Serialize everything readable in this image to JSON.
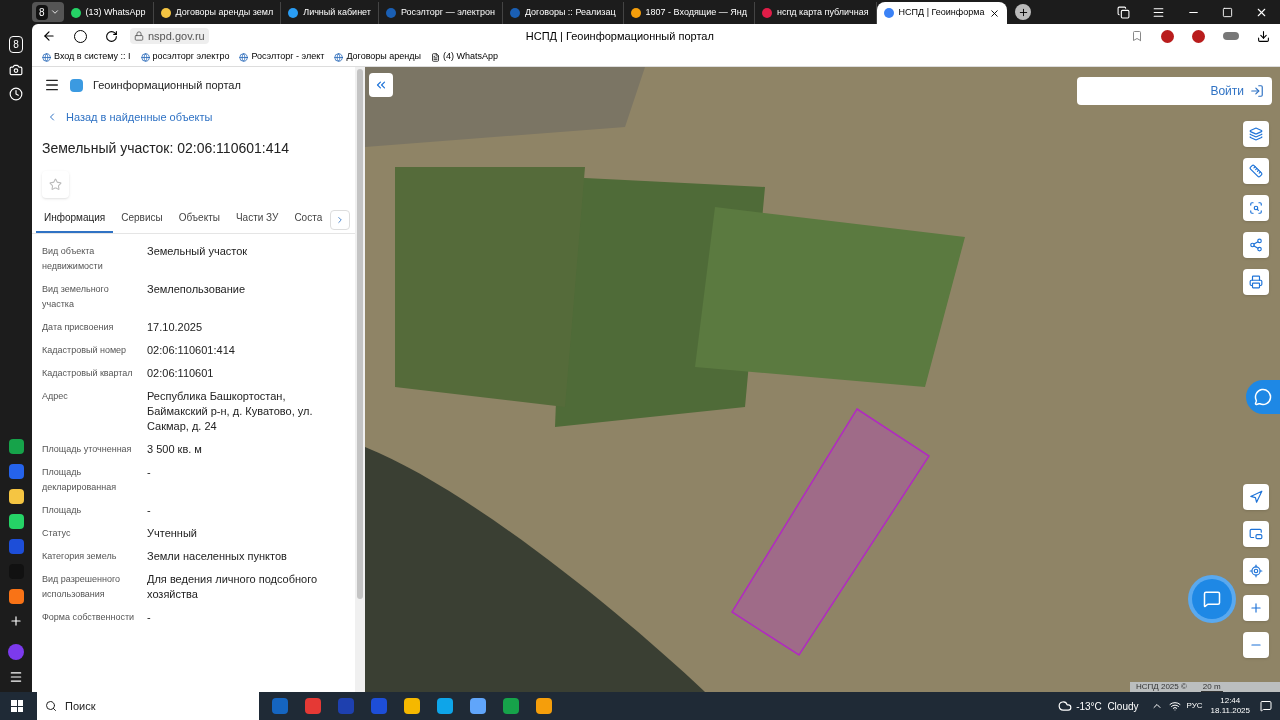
{
  "browser": {
    "group_count": "8",
    "tabs": [
      {
        "label": "(13) WhatsApp",
        "selected": false
      },
      {
        "label": "Договоры аренды земл",
        "selected": false
      },
      {
        "label": "Личный кабинет",
        "selected": false
      },
      {
        "label": "Росэлторг — электрон",
        "selected": false
      },
      {
        "label": "Договоры :: Реализац",
        "selected": false
      },
      {
        "label": "1807 - Входящие — Янд",
        "selected": false
      },
      {
        "label": "нспд карта публичная",
        "selected": false
      },
      {
        "label": "НСПД | Геоинформа",
        "selected": true
      }
    ],
    "address": "nspd.gov.ru",
    "page_title": "НСПД | Геоинформационный портал",
    "side_badge": "8",
    "bookmarks": [
      "Вход в систему :: I",
      "росэлторг электро",
      "Росэлторг - элект",
      "Договоры аренды",
      "(4) WhatsApp"
    ]
  },
  "portal": {
    "brand": "Геоинформационный портал",
    "back_link": "Назад в найденные объекты",
    "title": "Земельный участок: 02:06:110601:414",
    "tabs": [
      {
        "label": "Информация",
        "selected": true
      },
      {
        "label": "Сервисы",
        "selected": false
      },
      {
        "label": "Объекты",
        "selected": false
      },
      {
        "label": "Части ЗУ",
        "selected": false
      },
      {
        "label": "Соста",
        "selected": false
      }
    ],
    "fields": [
      {
        "label": "Вид объекта недвижимости",
        "value": "Земельный участок"
      },
      {
        "label": "Вид земельного участка",
        "value": "Землепользование"
      },
      {
        "label": "Дата присвоения",
        "value": "17.10.2025"
      },
      {
        "label": "Кадастровый номер",
        "value": "02:06:110601:414"
      },
      {
        "label": "Кадастровый квартал",
        "value": "02:06:110601"
      },
      {
        "label": "Адрес",
        "value": "Республика Башкортостан, Баймакский р-н, д. Куватово, ул. Сакмар, д. 24"
      },
      {
        "label": "Площадь уточненная",
        "value": "3 500 кв. м"
      },
      {
        "label": "Площадь декларированная",
        "value": "-"
      },
      {
        "label": "Площадь",
        "value": "-"
      },
      {
        "label": "Статус",
        "value": "Учтенный"
      },
      {
        "label": "Категория земель",
        "value": "Земли населенных пунктов"
      },
      {
        "label": "Вид разрешенного использования",
        "value": "Для ведения личного подсобного хозяйства"
      },
      {
        "label": "Форма собственности",
        "value": "-"
      }
    ]
  },
  "map": {
    "login": "Войти",
    "attribution": "НСПД 2025 ©",
    "scale": "20 m"
  },
  "taskbar": {
    "search": "Поиск",
    "weather": "-13°C  Cloudy",
    "lang": "РУС",
    "time": "12:44",
    "date": "18.11.2025"
  }
}
